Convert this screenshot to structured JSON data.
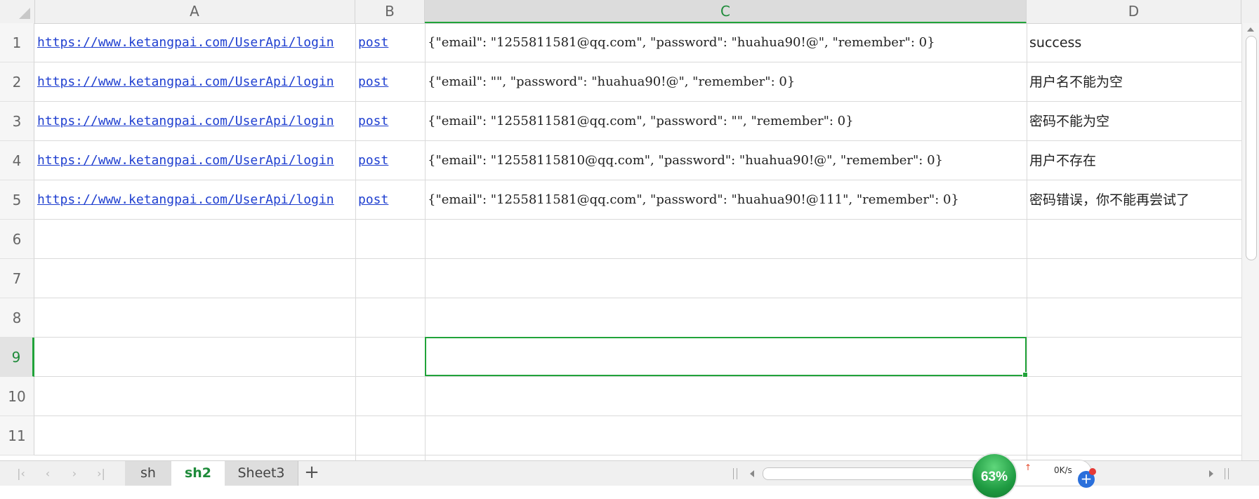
{
  "columns": [
    "A",
    "B",
    "C",
    "D"
  ],
  "rows": [
    "1",
    "2",
    "3",
    "4",
    "5",
    "6",
    "7",
    "8",
    "9",
    "10",
    "11"
  ],
  "cells": [
    {
      "a": "https://www.ketangpai.com/UserApi/login",
      "b": "post",
      "c": "{\"email\": \"1255811581@qq.com\", \"password\": \"huahua90!@\", \"remember\": 0}",
      "d": "success"
    },
    {
      "a": "https://www.ketangpai.com/UserApi/login",
      "b": "post",
      "c": "{\"email\": \"\", \"password\": \"huahua90!@\", \"remember\": 0}",
      "d": "用户名不能为空"
    },
    {
      "a": "https://www.ketangpai.com/UserApi/login",
      "b": "post",
      "c": "{\"email\": \"1255811581@qq.com\", \"password\": \"\", \"remember\": 0}",
      "d": "密码不能为空"
    },
    {
      "a": "https://www.ketangpai.com/UserApi/login",
      "b": "post",
      "c": "{\"email\": \"12558115810@qq.com\", \"password\": \"huahua90!@\", \"remember\": 0}",
      "d": "用户不存在"
    },
    {
      "a": "https://www.ketangpai.com/UserApi/login",
      "b": "post",
      "c": "{\"email\": \"1255811581@qq.com\", \"password\": \"huahua90!@111\", \"remember\": 0}",
      "d": "密码错误，你不能再尝试了"
    }
  ],
  "active_column": "C",
  "active_row": "9",
  "sheet_tabs": [
    "sh",
    "sh2",
    "Sheet3"
  ],
  "active_tab": "sh2",
  "add_tab_label": "+",
  "widget": {
    "percent": "63%",
    "speed": "0K/s"
  },
  "colors": {
    "accent": "#21a33a",
    "link": "#1f3fd0"
  }
}
